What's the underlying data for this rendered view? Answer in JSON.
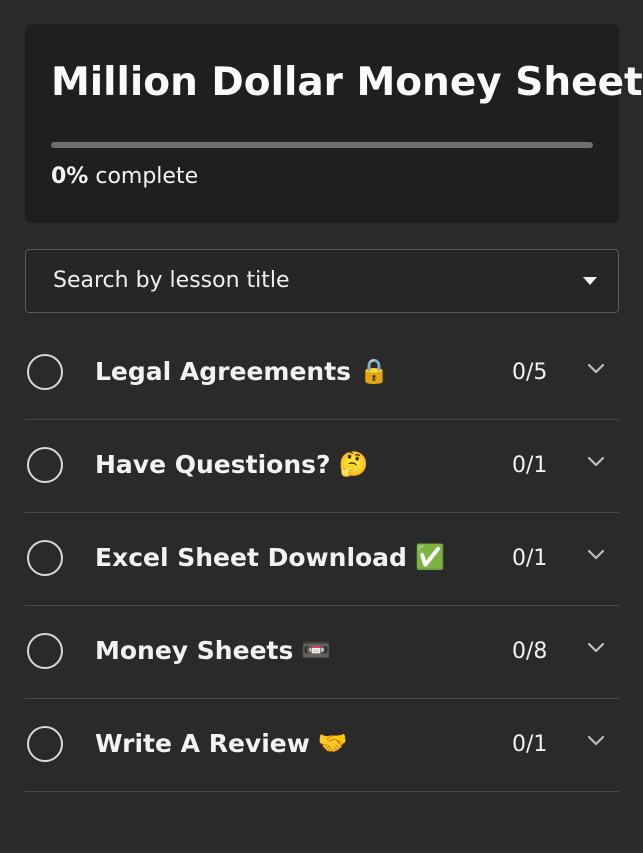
{
  "course": {
    "title": "Million Dollar Money Sheets",
    "progress_percent": 0,
    "progress_value": "0%",
    "progress_label": "complete"
  },
  "search": {
    "label": "Search by lesson title",
    "icon": "caret-down-icon"
  },
  "lessons": [
    {
      "label": "Legal Agreements",
      "emoji": "🔒",
      "icon": "lock-icon",
      "count": "0/5"
    },
    {
      "label": "Have Questions?",
      "emoji": "🤔",
      "icon": "thinking-face-icon",
      "count": "0/1"
    },
    {
      "label": "Excel Sheet Download",
      "emoji": "✅",
      "icon": "checkmark-box-icon",
      "count": "0/1"
    },
    {
      "label": "Money Sheets",
      "emoji": "📼",
      "icon": "video-cassette-icon",
      "count": "0/8"
    },
    {
      "label": "Write A Review",
      "emoji": "🤝",
      "icon": "handshake-icon",
      "count": "0/1"
    }
  ],
  "colors": {
    "background": "#2a2a2a",
    "panel": "#1f1f1f",
    "text": "#f3f3f3",
    "divider": "#4b4b4b"
  }
}
